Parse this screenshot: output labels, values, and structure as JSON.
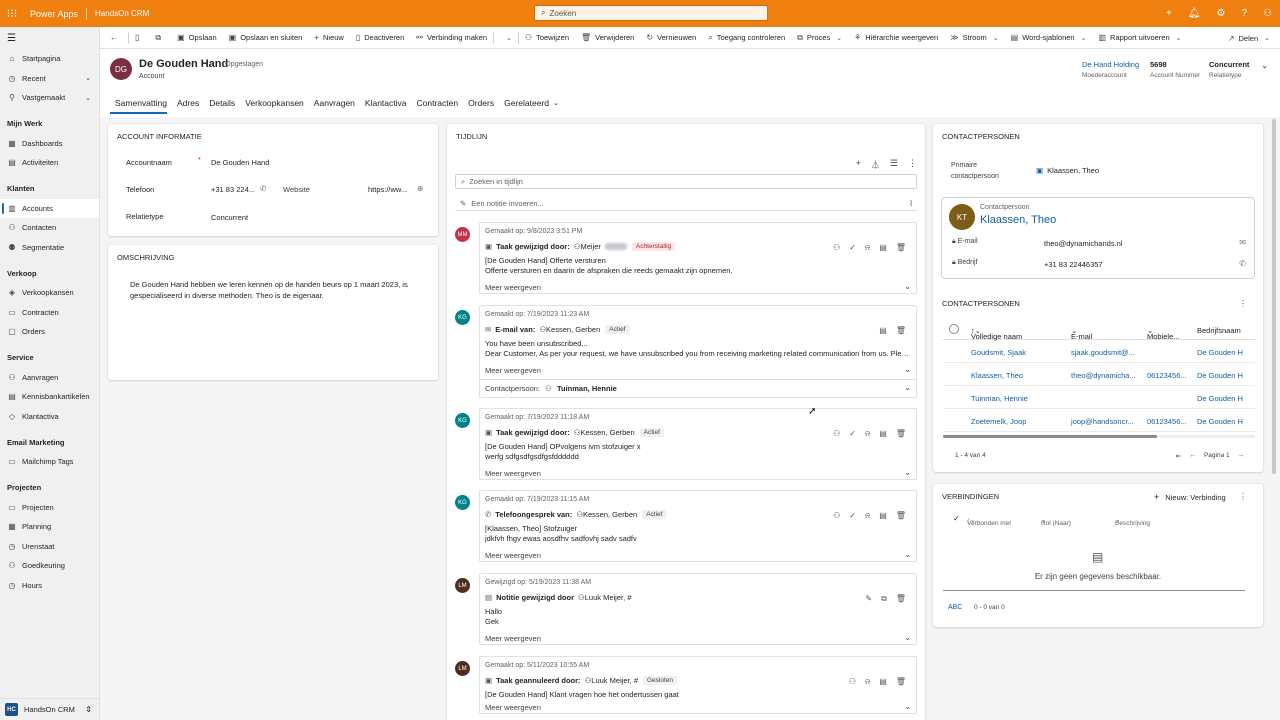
{
  "topbar": {
    "app_name": "Power Apps",
    "env_name": "HandsOn CRM",
    "search_placeholder": "Zoeken"
  },
  "nav": {
    "top": [
      {
        "label": "Startpagina",
        "icon": "home-icon"
      },
      {
        "label": "Recent",
        "icon": "clock-icon"
      },
      {
        "label": "Vastgemaakt",
        "icon": "pin-icon"
      }
    ],
    "sections": [
      {
        "title": "Mijn Werk",
        "items": [
          {
            "label": "Dashboards"
          },
          {
            "label": "Activiteiten"
          }
        ]
      },
      {
        "title": "Klanten",
        "items": [
          {
            "label": "Accounts"
          },
          {
            "label": "Contacten"
          },
          {
            "label": "Segmentatie"
          }
        ]
      },
      {
        "title": "Verkoop",
        "items": [
          {
            "label": "Verkoopkansen"
          },
          {
            "label": "Contracten"
          },
          {
            "label": "Orders"
          }
        ]
      },
      {
        "title": "Service",
        "items": [
          {
            "label": "Aanvragen"
          },
          {
            "label": "Kennisbankartikelen"
          },
          {
            "label": "Klantactiva"
          }
        ]
      },
      {
        "title": "Email Marketing",
        "items": [
          {
            "label": "Mailchimp Tags"
          }
        ]
      },
      {
        "title": "Projecten",
        "items": [
          {
            "label": "Projecten"
          },
          {
            "label": "Planning"
          },
          {
            "label": "Urenstaat"
          },
          {
            "label": "Goedkeuring"
          },
          {
            "label": "Hours"
          }
        ]
      }
    ],
    "footer_badge": "HC",
    "footer_label": "HandsOn CRM"
  },
  "commands": {
    "save": "Opslaan",
    "save_close": "Opslaan en sluiten",
    "new": "Nieuw",
    "deactivate": "Deactiveren",
    "connect": "Verbinding maken",
    "assign": "Toewijzen",
    "delete": "Verwijderen",
    "refresh": "Vernieuwen",
    "check_access": "Toegang controleren",
    "process": "Proces",
    "hierarchy": "Hiërarchie weergeven",
    "flow": "Stroom",
    "word": "Word-sjablonen",
    "report": "Rapport uitvoeren",
    "share": "Delen"
  },
  "header": {
    "initials": "DG",
    "title": "De Gouden Hand",
    "saved": "- Opgeslagen",
    "entity": "Account",
    "fields": [
      {
        "value": "De Hand Holding",
        "label": "Moederaccount"
      },
      {
        "value": "5698",
        "label": "Account Nummer"
      },
      {
        "value": "Concurrent",
        "label": "Relatietype"
      }
    ],
    "tabs": [
      "Samenvatting",
      "Adres",
      "Details",
      "Verkoopkansen",
      "Aanvragen",
      "Klantactiva",
      "Contracten",
      "Orders",
      "Gerelateerd"
    ]
  },
  "account_info": {
    "title": "ACCOUNT INFORMATIE",
    "name_label": "Accountnaam",
    "name_value": "De Gouden Hand",
    "phone_label": "Telefoon",
    "phone_value": "+31 83 224...",
    "website_label": "Website",
    "website_value": "https://ww...",
    "relation_label": "Relatietype",
    "relation_value": "Concurrent"
  },
  "description": {
    "title": "OMSCHRIJVING",
    "text": "De Gouden Hand hebben we leren kennen op de handen beurs op 1 maart 2023, is gespecialiseerd in diverse methoden.  Theo is de eigenaar."
  },
  "timeline": {
    "title": "TIJDLIJN",
    "search_placeholder": "Zoeken in tijdlijn",
    "note_placeholder": "Een notitie invoeren...",
    "more": "Meer weergeven",
    "items": [
      {
        "initials": "MM",
        "color": "#c4314b",
        "meta": "Gemaakt op: 9/8/2023 3:51 PM",
        "head": "Taak gewijzigd door:",
        "person": "Meijer",
        "pill": "Achterstallig",
        "lines": [
          "[De Gouden Hand] Offerte versturen",
          "Offerte versturen en daarin de afspraken die reeds gemaakt zijn opnemen."
        ]
      },
      {
        "initials": "KG",
        "color": "#038387",
        "meta": "Gemaakt op: 7/19/2023 11:23 AM",
        "head": "E-mail van:",
        "person": "Kessen, Gerben",
        "pill": "Actief",
        "lines": [
          "You have been unsubscribed...",
          "Dear Customer, As per your request, we have unsubscribed you from receiving marketing related communication from us. Please call us..."
        ],
        "contact_label": "Contactpersoon:",
        "contact": "Tuinman, Hennie"
      },
      {
        "initials": "KG",
        "color": "#038387",
        "meta": "Gemaakt op: 7/19/2023 11:18 AM",
        "head": "Taak gewijzigd door:",
        "person": "Kessen, Gerben",
        "pill": "Actief",
        "lines": [
          "[De Gouden Hand] OPvolgens ivm stofzuiger x",
          "werfg sdfgsdfgsdfgsfdddddd"
        ]
      },
      {
        "initials": "KG",
        "color": "#038387",
        "meta": "Gemaakt op: 7/19/2023 11:15 AM",
        "head": "Telefoongesprek van:",
        "person": "Kessen, Gerben",
        "pill": "Actief",
        "lines": [
          "[Klaassen, Theo] Stofzuiger",
          "jdkfvh fhgv ewas aosdfhv sadfovhj sadv sadfv"
        ]
      },
      {
        "initials": "LM",
        "color": "#4f2d1f",
        "meta": "Gewijzigd op: 5/19/2023 11:38 AM",
        "head": "Notitie gewijzigd door",
        "person": "Luuk Meijer, #",
        "pill": "",
        "lines": [
          "Hallo",
          "Gek"
        ]
      },
      {
        "initials": "LM",
        "color": "#4f2d1f",
        "meta": "Gemaakt op: 5/11/2023 10:55 AM",
        "head": "Taak geannuleerd door:",
        "person": "Luuk Meijer, #",
        "pill": "Gesloten",
        "lines": [
          "[De Gouden Hand] Klant vragen hoe het ondertussen gaat"
        ]
      }
    ]
  },
  "contacts": {
    "title": "CONTACTPERSONEN",
    "primary_label_1": "Primaire",
    "primary_label_2": "contactpersoon",
    "primary_value": "Klaassen, Theo",
    "card": {
      "initials": "KT",
      "role": "Contactpersoon",
      "name": "Klaassen, Theo",
      "email_label": "E-mail",
      "email": "theo@dynamichands.nl",
      "company_label": "Bedrijf",
      "phone": "+31 83 22446357"
    },
    "grid_title": "CONTACTPERSONEN",
    "columns": [
      "Volledige naam",
      "E-mail",
      "Mobiele...",
      "Bedrijfsnaam"
    ],
    "rows": [
      {
        "name": "Goudsmit, Sjaak",
        "email": "sjaak.goudsmit@...",
        "mobile": "",
        "company": "De Gouden H"
      },
      {
        "name": "Klaassen, Theo",
        "email": "theo@dynamicha...",
        "mobile": "06123456...",
        "company": "De Gouden H"
      },
      {
        "name": "Tuinman, Hennie",
        "email": "",
        "mobile": "",
        "company": "De Gouden H"
      },
      {
        "name": "Zoetemelk, Joop",
        "email": "joop@handsoncr...",
        "mobile": "06123456...",
        "company": "De Gouden H"
      }
    ],
    "count": "1 - 4 van 4",
    "page": "Pagina 1"
  },
  "connections": {
    "title": "VERBINDINGEN",
    "new": "Nieuw: Verbinding",
    "columns": [
      "Verbonden met",
      "Rol (Naar)",
      "Beschrijving"
    ],
    "empty": "Er zijn geen gegevens beschikbaar.",
    "abc": "ABC",
    "count": "0 - 0 van 0"
  }
}
